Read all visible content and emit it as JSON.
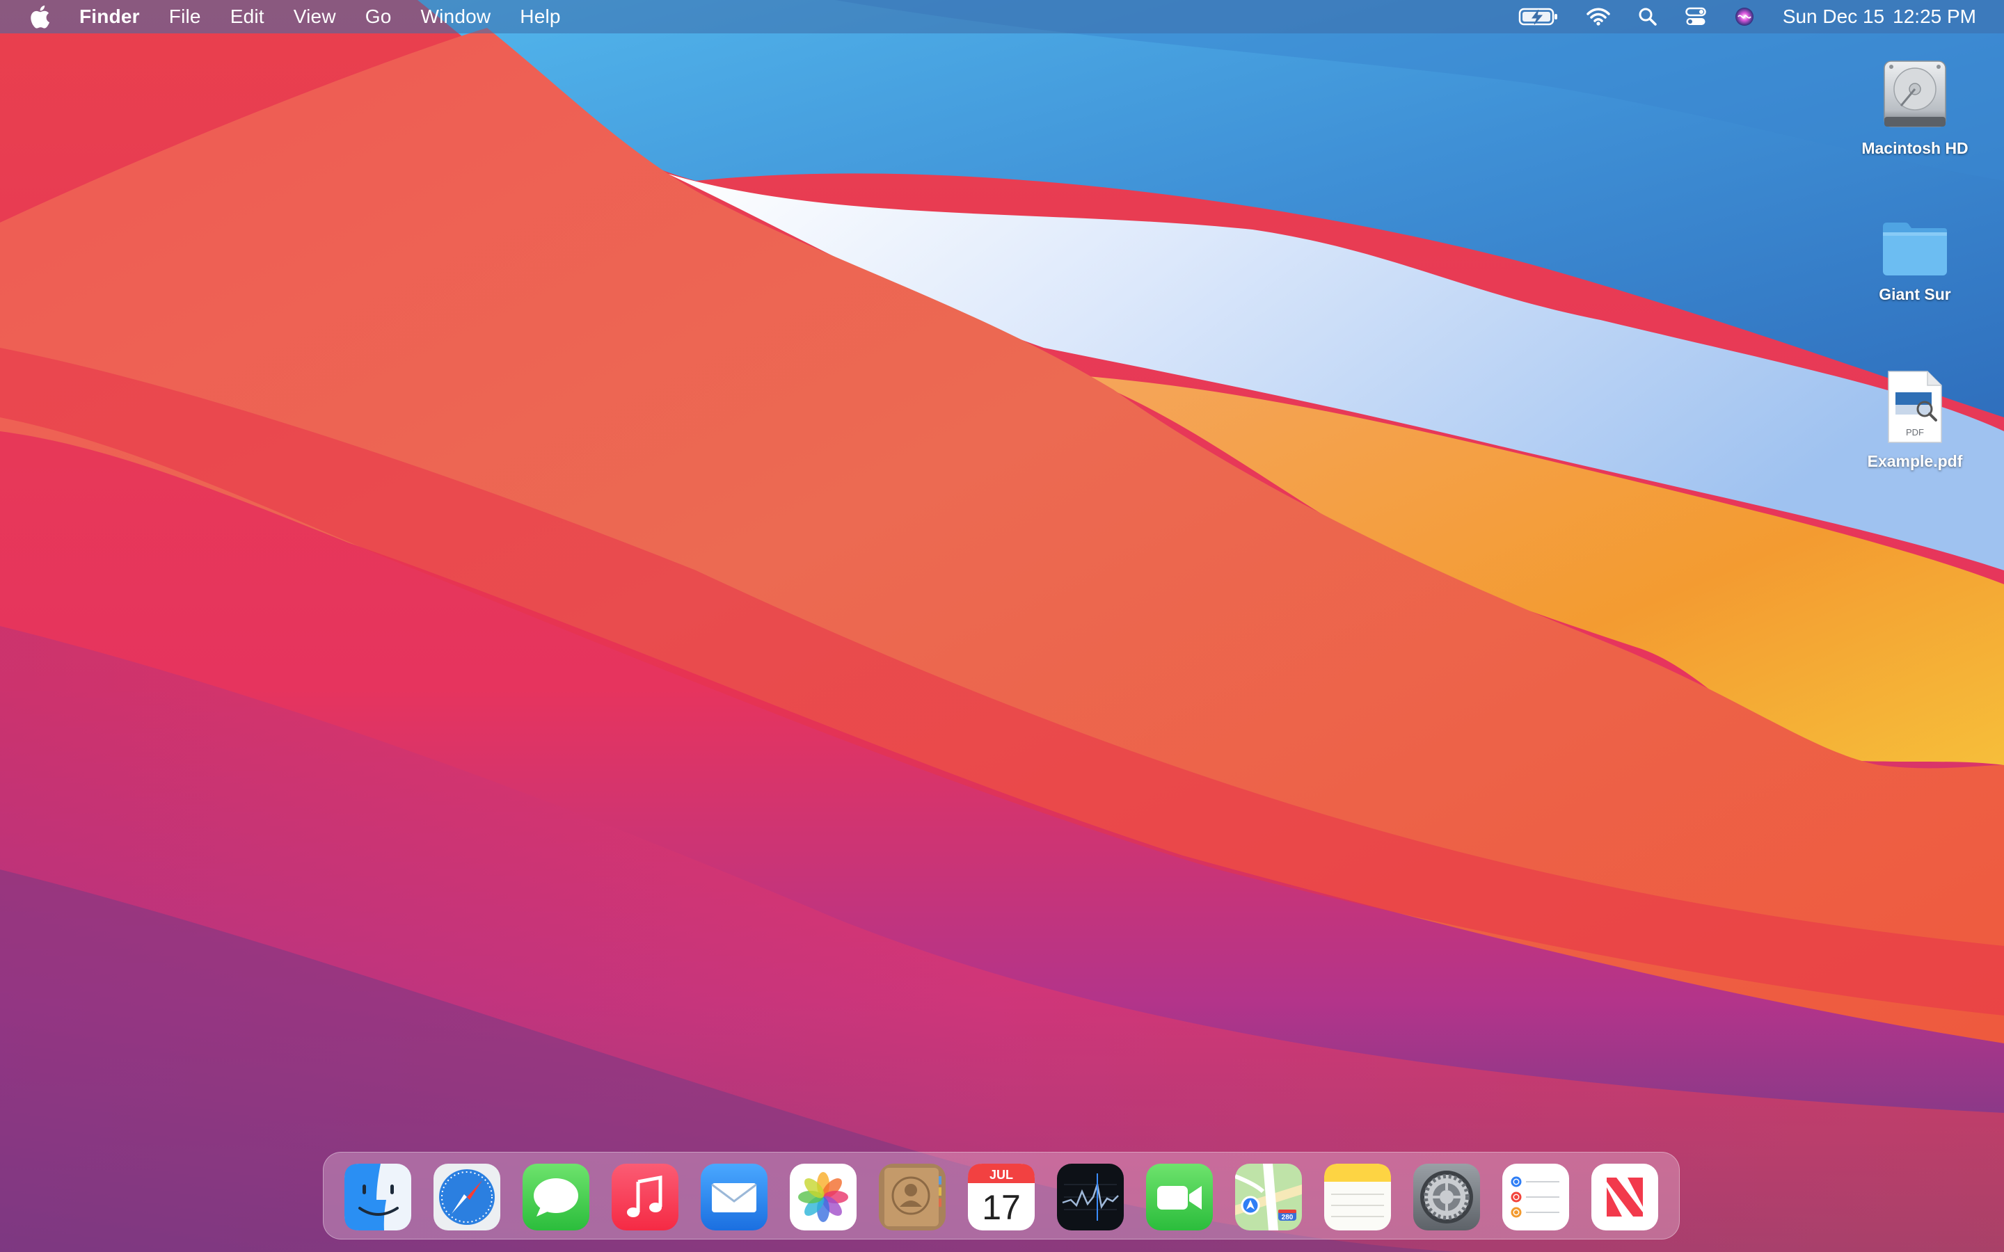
{
  "menubar": {
    "app_name": "Finder",
    "menus": [
      "File",
      "Edit",
      "View",
      "Go",
      "Window",
      "Help"
    ],
    "status_icons": [
      "battery-charging-icon",
      "wifi-icon",
      "spotlight-search-icon",
      "control-center-icon",
      "siri-icon"
    ],
    "clock": {
      "date": "Sun Dec 15",
      "time": "12:25 PM"
    }
  },
  "desktop": {
    "icons": [
      {
        "label": "Macintosh HD",
        "icon": "hard-drive-icon"
      },
      {
        "label": "Giant Sur",
        "icon": "folder-icon"
      },
      {
        "label": "Example.pdf",
        "icon": "pdf-document-icon",
        "badge": "PDF"
      }
    ]
  },
  "dock": {
    "apps": [
      {
        "name": "Finder",
        "icon": "finder-icon"
      },
      {
        "name": "Safari",
        "icon": "safari-icon"
      },
      {
        "name": "Messages",
        "icon": "messages-icon"
      },
      {
        "name": "Music",
        "icon": "music-icon"
      },
      {
        "name": "Mail",
        "icon": "mail-icon"
      },
      {
        "name": "Photos",
        "icon": "photos-icon"
      },
      {
        "name": "Contacts",
        "icon": "contacts-icon"
      },
      {
        "name": "Calendar",
        "icon": "calendar-icon",
        "month": "JUL",
        "day": "17"
      },
      {
        "name": "Stocks",
        "icon": "stocks-icon"
      },
      {
        "name": "FaceTime",
        "icon": "facetime-icon"
      },
      {
        "name": "Maps",
        "icon": "maps-icon",
        "badge": "280"
      },
      {
        "name": "Notes",
        "icon": "notes-icon"
      },
      {
        "name": "System Preferences",
        "icon": "system-preferences-icon"
      },
      {
        "name": "Reminders",
        "icon": "reminders-icon"
      },
      {
        "name": "News",
        "icon": "news-icon"
      }
    ]
  },
  "colors": {
    "wallpaper_blue": "#3f8fd6",
    "wallpaper_red": "#e8374c",
    "wallpaper_orange": "#f2a23a",
    "wallpaper_magenta": "#d8357a",
    "menu_text": "#ffffff"
  }
}
